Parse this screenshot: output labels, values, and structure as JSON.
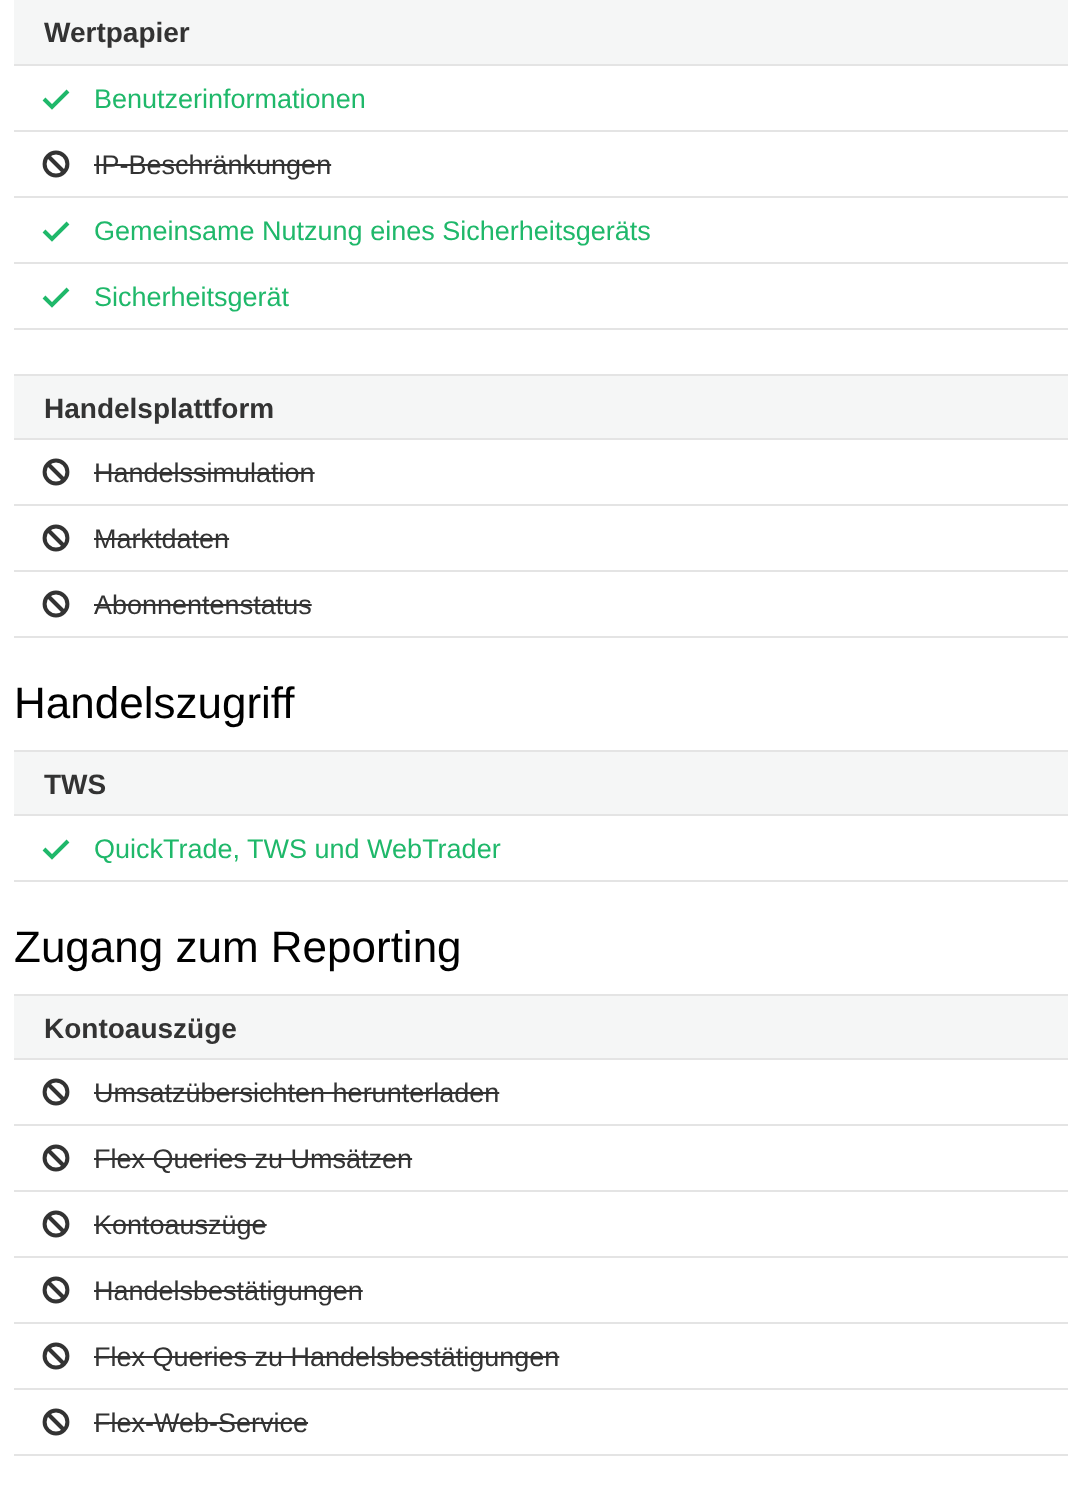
{
  "blocks": [
    {
      "kind": "table",
      "header": "Wertpapier",
      "items": [
        {
          "label": "Benutzerinformationen",
          "enabled": true
        },
        {
          "label": "IP-Beschränkungen",
          "enabled": false
        },
        {
          "label": "Gemeinsame Nutzung eines Sicherheitsgeräts",
          "enabled": true
        },
        {
          "label": "Sicherheitsgerät",
          "enabled": true
        }
      ]
    },
    {
      "kind": "table",
      "header": "Handelsplattform",
      "items": [
        {
          "label": "Handelssimulation",
          "enabled": false
        },
        {
          "label": "Marktdaten",
          "enabled": false
        },
        {
          "label": "Abonnentenstatus",
          "enabled": false
        }
      ]
    },
    {
      "kind": "heading",
      "text": "Handelszugriff"
    },
    {
      "kind": "table",
      "header": "TWS",
      "items": [
        {
          "label": "QuickTrade, TWS und WebTrader",
          "enabled": true
        }
      ]
    },
    {
      "kind": "heading",
      "text": "Zugang zum Reporting"
    },
    {
      "kind": "table",
      "header": "Kontoauszüge",
      "items": [
        {
          "label": "Umsatzübersichten herunterladen",
          "enabled": false
        },
        {
          "label": "Flex Queries zu Umsätzen",
          "enabled": false
        },
        {
          "label": "Kontoauszüge",
          "enabled": false
        },
        {
          "label": "Handelsbestätigungen",
          "enabled": false
        },
        {
          "label": "Flex Queries zu Handelsbestätigungen",
          "enabled": false
        },
        {
          "label": "Flex-Web-Service",
          "enabled": false
        }
      ]
    }
  ]
}
